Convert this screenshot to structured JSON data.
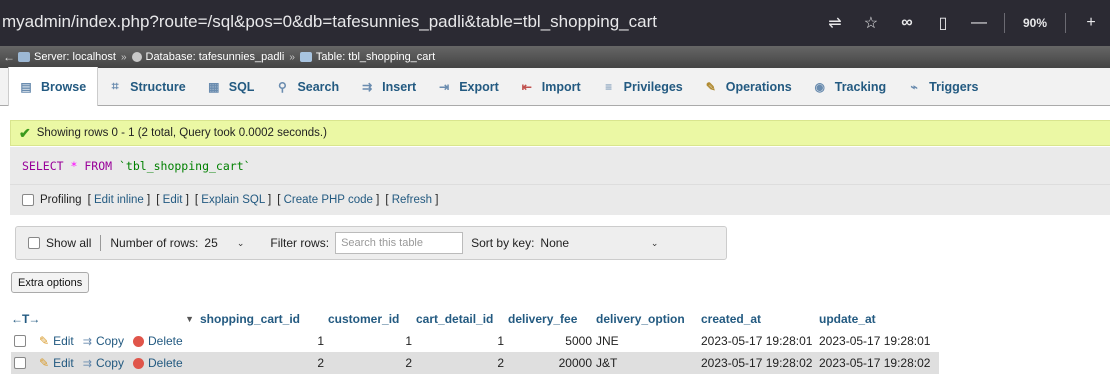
{
  "browser": {
    "url": "myadmin/index.php?route=/sql&pos=0&db=tafesunnies_padli&table=tbl_shopping_cart",
    "zoom": "90%",
    "icons": [
      "translate-icon",
      "star-icon",
      "infinity-icon",
      "reader-icon"
    ]
  },
  "breadcrumb": {
    "server": "Server: localhost",
    "database": "Database: tafesunnies_padli",
    "table": "Table: tbl_shopping_cart",
    "sep": "»"
  },
  "tabs": [
    {
      "label": "Browse",
      "icon": "browse-icon"
    },
    {
      "label": "Structure",
      "icon": "structure-icon"
    },
    {
      "label": "SQL",
      "icon": "sql-icon"
    },
    {
      "label": "Search",
      "icon": "search-icon"
    },
    {
      "label": "Insert",
      "icon": "insert-icon"
    },
    {
      "label": "Export",
      "icon": "export-icon"
    },
    {
      "label": "Import",
      "icon": "import-icon"
    },
    {
      "label": "Privileges",
      "icon": "privileges-icon"
    },
    {
      "label": "Operations",
      "icon": "operations-icon"
    },
    {
      "label": "Tracking",
      "icon": "tracking-icon"
    },
    {
      "label": "Triggers",
      "icon": "triggers-icon"
    }
  ],
  "status": {
    "message": "Showing rows 0 - 1 (2 total, Query took 0.0002 seconds.)"
  },
  "sql": {
    "select": "SELECT",
    "star": "*",
    "from": "FROM",
    "table": "`tbl_shopping_cart`"
  },
  "profiling": {
    "label": "Profiling",
    "open": "[",
    "close": "]",
    "links": [
      "Edit inline",
      "Edit",
      "Explain SQL",
      "Create PHP code",
      "Refresh"
    ]
  },
  "nav": {
    "show_all": "Show all",
    "rows_label": "Number of rows:",
    "rows_value": "25",
    "filter_label": "Filter rows:",
    "filter_placeholder": "Search this table",
    "sort_label": "Sort by key:",
    "sort_value": "None"
  },
  "extra_options": "Extra options",
  "table": {
    "arrows": "←T→",
    "columns": [
      "shopping_cart_id",
      "customer_id",
      "cart_detail_id",
      "delivery_fee",
      "delivery_option",
      "created_at",
      "update_at"
    ],
    "actions": {
      "edit": "Edit",
      "copy": "Copy",
      "delete": "Delete"
    },
    "rows": [
      [
        "1",
        "1",
        "1",
        "5000",
        "JNE",
        "2023-05-17 19:28:01",
        "2023-05-17 19:28:01"
      ],
      [
        "2",
        "2",
        "2",
        "20000",
        "J&T",
        "2023-05-17 19:28:02",
        "2023-05-17 19:28:02"
      ]
    ]
  },
  "colors": {
    "link": "#235a81",
    "success_bg": "#ebf8a4",
    "breadcrumb_bg": "#555555",
    "browser_bg": "#2b2a33"
  }
}
